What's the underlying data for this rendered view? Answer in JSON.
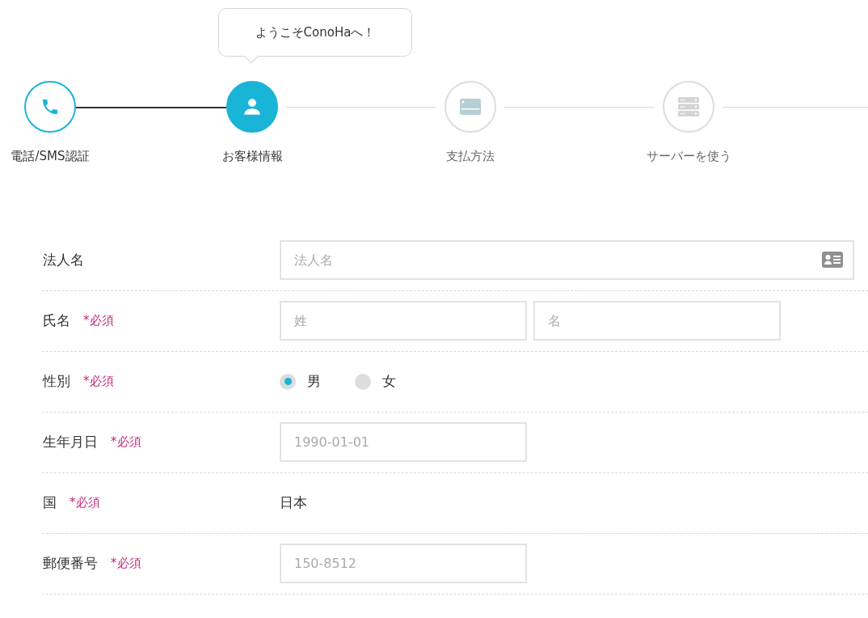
{
  "steps": [
    {
      "label": "電話/SMS認証",
      "kind": "phone",
      "completed": true,
      "selected": false
    },
    {
      "label": "お客様情報",
      "kind": "person",
      "completed": false,
      "selected": true,
      "tooltip": "ようこそConoHaへ！"
    },
    {
      "label": "支払方法",
      "kind": "card",
      "completed": false,
      "selected": false
    },
    {
      "label": "サーバーを使う",
      "kind": "server",
      "completed": false,
      "selected": false
    }
  ],
  "form": [
    {
      "label": "法人名",
      "kind": "text",
      "wide": true,
      "card_icon": true,
      "inputs": [
        {
          "placeholder": "法人名"
        }
      ]
    },
    {
      "label": "氏名",
      "required_mark": "*必須",
      "kind": "text",
      "inputs": [
        {
          "placeholder": "姓"
        },
        {
          "placeholder": "名"
        }
      ]
    },
    {
      "label": "性別",
      "required_mark": "*必須",
      "kind": "radio",
      "options": [
        {
          "label": "男",
          "selected": true
        },
        {
          "label": "女",
          "selected": false
        }
      ]
    },
    {
      "label": "生年月日",
      "required_mark": "*必須",
      "kind": "text",
      "inputs": [
        {
          "placeholder": "1990-01-01"
        }
      ]
    },
    {
      "label": "国",
      "required_mark": "*必須",
      "kind": "value",
      "value": "日本"
    },
    {
      "label": "郵便番号",
      "required_mark": "*必須",
      "kind": "text",
      "inputs": [
        {
          "placeholder": "150-8512"
        }
      ]
    }
  ]
}
